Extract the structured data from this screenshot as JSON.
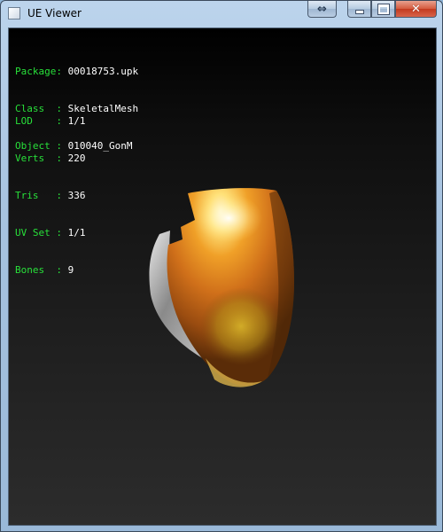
{
  "window": {
    "title": "UE Viewer",
    "buttons": {
      "restore_alt": "⇔",
      "minimize": "",
      "maximize": "",
      "close": "✕"
    }
  },
  "info_block_1": [
    {
      "key": "Package",
      "sep": ": ",
      "value": "00018753.upk"
    },
    {
      "key": "Class  ",
      "sep": ": ",
      "value": "SkeletalMesh"
    },
    {
      "key": "Object ",
      "sep": ": ",
      "value": "010040_GonM"
    }
  ],
  "info_block_2": [
    {
      "key": "LOD    ",
      "sep": ": ",
      "value": "1/1"
    },
    {
      "key": "Verts  ",
      "sep": ": ",
      "value": "220"
    },
    {
      "key": "Tris   ",
      "sep": ": ",
      "value": "336"
    },
    {
      "key": "UV Set ",
      "sep": ": ",
      "value": "1/1"
    },
    {
      "key": "Bones  ",
      "sep": ": ",
      "value": "9"
    }
  ],
  "colors": {
    "label": "#28e03a",
    "value": "#ffffff",
    "viewport_bg": "#000000"
  }
}
